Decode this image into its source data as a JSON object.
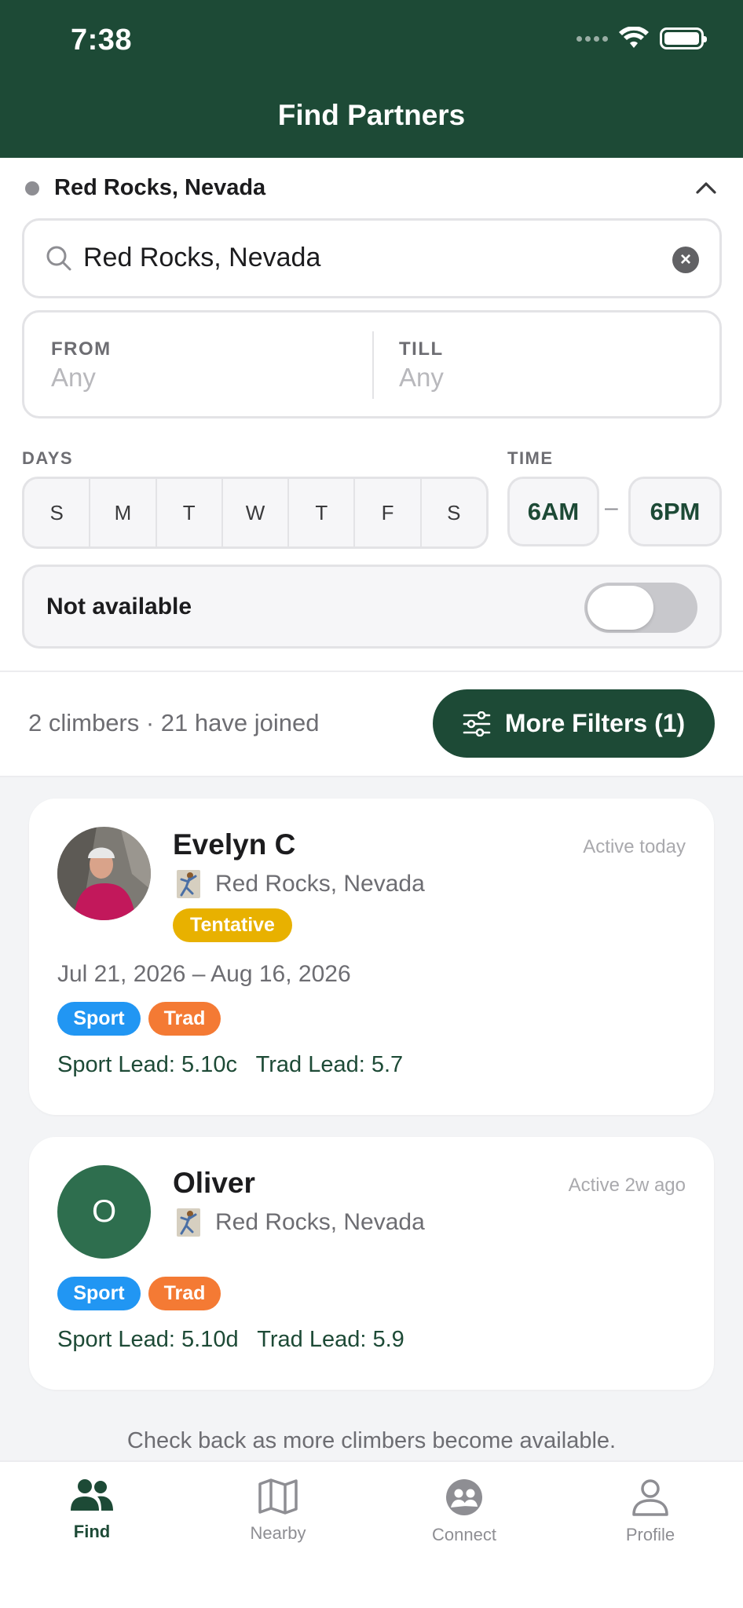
{
  "status": {
    "time": "7:38"
  },
  "header": {
    "title": "Find Partners"
  },
  "location": {
    "current": "Red Rocks, Nevada"
  },
  "search": {
    "value": "Red Rocks, Nevada"
  },
  "dates": {
    "from_label": "FROM",
    "from_value": "Any",
    "till_label": "TILL",
    "till_value": "Any"
  },
  "days": {
    "label": "DAYS",
    "items": [
      "S",
      "M",
      "T",
      "W",
      "T",
      "F",
      "S"
    ]
  },
  "time": {
    "label": "TIME",
    "start": "6AM",
    "dash": "–",
    "end": "6PM"
  },
  "not_available": {
    "label": "Not available",
    "on": false
  },
  "results": {
    "summary": "2 climbers · 21 have joined",
    "filter_button": "More Filters (1)"
  },
  "climbers": [
    {
      "name": "Evelyn C",
      "active": "Active today",
      "location": "Red Rocks, Nevada",
      "status": "Tentative",
      "dates": "Jul 21, 2026 – Aug 16, 2026",
      "tags": [
        "Sport",
        "Trad"
      ],
      "grades": "Sport Lead: 5.10c   Trad Lead: 5.7"
    },
    {
      "name": "Oliver",
      "initial": "O",
      "active": "Active 2w ago",
      "location": "Red Rocks, Nevada",
      "tags": [
        "Sport",
        "Trad"
      ],
      "grades": "Sport Lead: 5.10d   Trad Lead: 5.9"
    }
  ],
  "footer_note": "Check back as more climbers become available.",
  "tabs": [
    {
      "label": "Find",
      "icon": "people-icon",
      "active": true
    },
    {
      "label": "Nearby",
      "icon": "map-icon",
      "active": false
    },
    {
      "label": "Connect",
      "icon": "connect-icon",
      "active": false
    },
    {
      "label": "Profile",
      "icon": "profile-icon",
      "active": false
    }
  ],
  "colors": {
    "brand": "#1d4a36",
    "sport": "#2196f3",
    "trad": "#f47a34",
    "tentative": "#e8b100"
  }
}
